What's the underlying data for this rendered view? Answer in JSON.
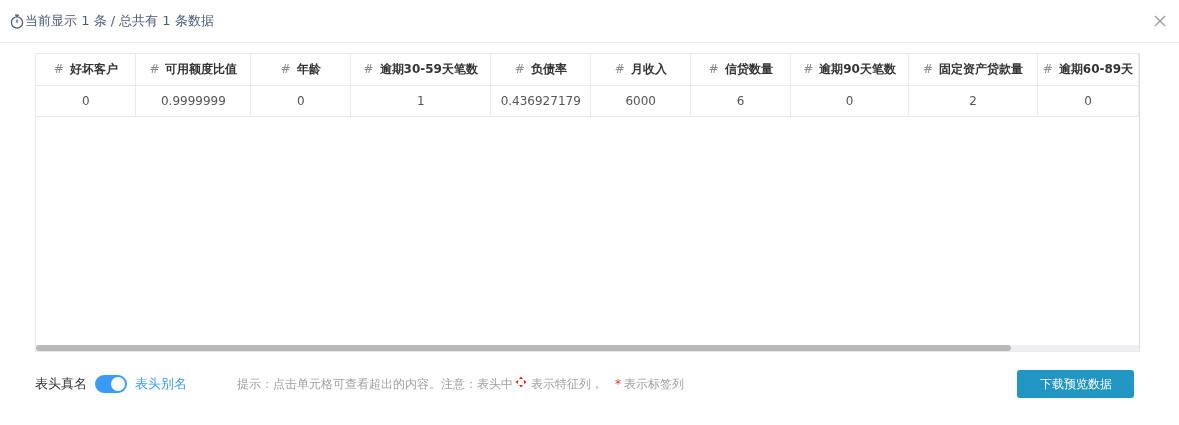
{
  "dialog": {
    "title": "当前显示 1 条 / 总共有 1 条数据"
  },
  "table": {
    "columns": [
      {
        "hash": "#",
        "label": "好坏客户"
      },
      {
        "hash": "#",
        "label": "可用额度比值"
      },
      {
        "hash": "#",
        "label": "年龄"
      },
      {
        "hash": "#",
        "label": "逾期30-59天笔数"
      },
      {
        "hash": "#",
        "label": "负债率"
      },
      {
        "hash": "#",
        "label": "月收入"
      },
      {
        "hash": "#",
        "label": "信贷数量"
      },
      {
        "hash": "#",
        "label": "逾期90天笔数"
      },
      {
        "hash": "#",
        "label": "固定资产贷款量"
      },
      {
        "hash": "#",
        "label": "逾期60-89天"
      }
    ],
    "rows": [
      [
        "0",
        "0.9999999",
        "0",
        "1",
        "0.436927179",
        "6000",
        "6",
        "0",
        "2",
        "0"
      ]
    ]
  },
  "footer": {
    "toggle_left_label": "表头真名",
    "toggle_on": true,
    "toggle_right_label": "表头别名",
    "hint_prefix": "提示：点击单元格可查看超出的内容。注意：表头中",
    "hint_feature": "表示特征列，",
    "asterisk": "*",
    "hint_label": "表示标签列",
    "download_button": "下载预览数据"
  }
}
